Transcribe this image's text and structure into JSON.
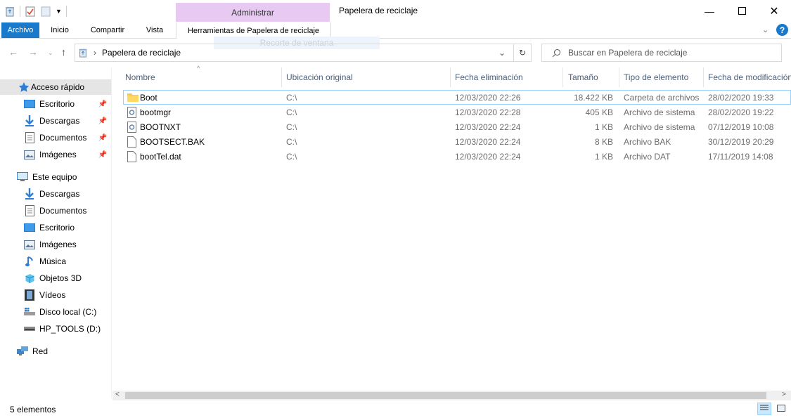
{
  "window": {
    "title": "Papelera de reciclaje",
    "context_group": "Administrar",
    "ghost_tooltip": "Recorte de ventana"
  },
  "ribbon": {
    "tabs": [
      "Archivo",
      "Inicio",
      "Compartir",
      "Vista",
      "Herramientas de Papelera de reciclaje"
    ]
  },
  "address": {
    "path": "Papelera de reciclaje",
    "search_placeholder": "Buscar en Papelera de reciclaje"
  },
  "sidebar": {
    "quick_access": {
      "label": "Acceso rápido",
      "items": [
        "Escritorio",
        "Descargas",
        "Documentos",
        "Imágenes"
      ]
    },
    "this_pc": {
      "label": "Este equipo",
      "items": [
        "Descargas",
        "Documentos",
        "Escritorio",
        "Imágenes",
        "Música",
        "Objetos 3D",
        "Vídeos",
        "Disco local (C:)",
        "HP_TOOLS (D:)"
      ]
    },
    "network": {
      "label": "Red"
    }
  },
  "columns": [
    "Nombre",
    "Ubicación original",
    "Fecha eliminación",
    "Tamaño",
    "Tipo de elemento",
    "Fecha de modificación"
  ],
  "files": [
    {
      "name": "Boot",
      "location": "C:\\",
      "deleted": "12/03/2020 22:26",
      "size": "18.422 KB",
      "type": "Carpeta de archivos",
      "modified": "28/02/2020 19:33"
    },
    {
      "name": "bootmgr",
      "location": "C:\\",
      "deleted": "12/03/2020 22:28",
      "size": "405 KB",
      "type": "Archivo de sistema",
      "modified": "28/02/2020 19:22"
    },
    {
      "name": "BOOTNXT",
      "location": "C:\\",
      "deleted": "12/03/2020 22:24",
      "size": "1 KB",
      "type": "Archivo de sistema",
      "modified": "07/12/2019 10:08"
    },
    {
      "name": "BOOTSECT.BAK",
      "location": "C:\\",
      "deleted": "12/03/2020 22:24",
      "size": "8 KB",
      "type": "Archivo BAK",
      "modified": "30/12/2019 20:29"
    },
    {
      "name": "bootTel.dat",
      "location": "C:\\",
      "deleted": "12/03/2020 22:24",
      "size": "1 KB",
      "type": "Archivo DAT",
      "modified": "17/11/2019 14:08"
    }
  ],
  "status": {
    "count": "5 elementos"
  },
  "colors": {
    "accent": "#1979ca",
    "context": "#e7c9f2",
    "folder": "#f5c94c",
    "header_text": "#4c607a"
  }
}
